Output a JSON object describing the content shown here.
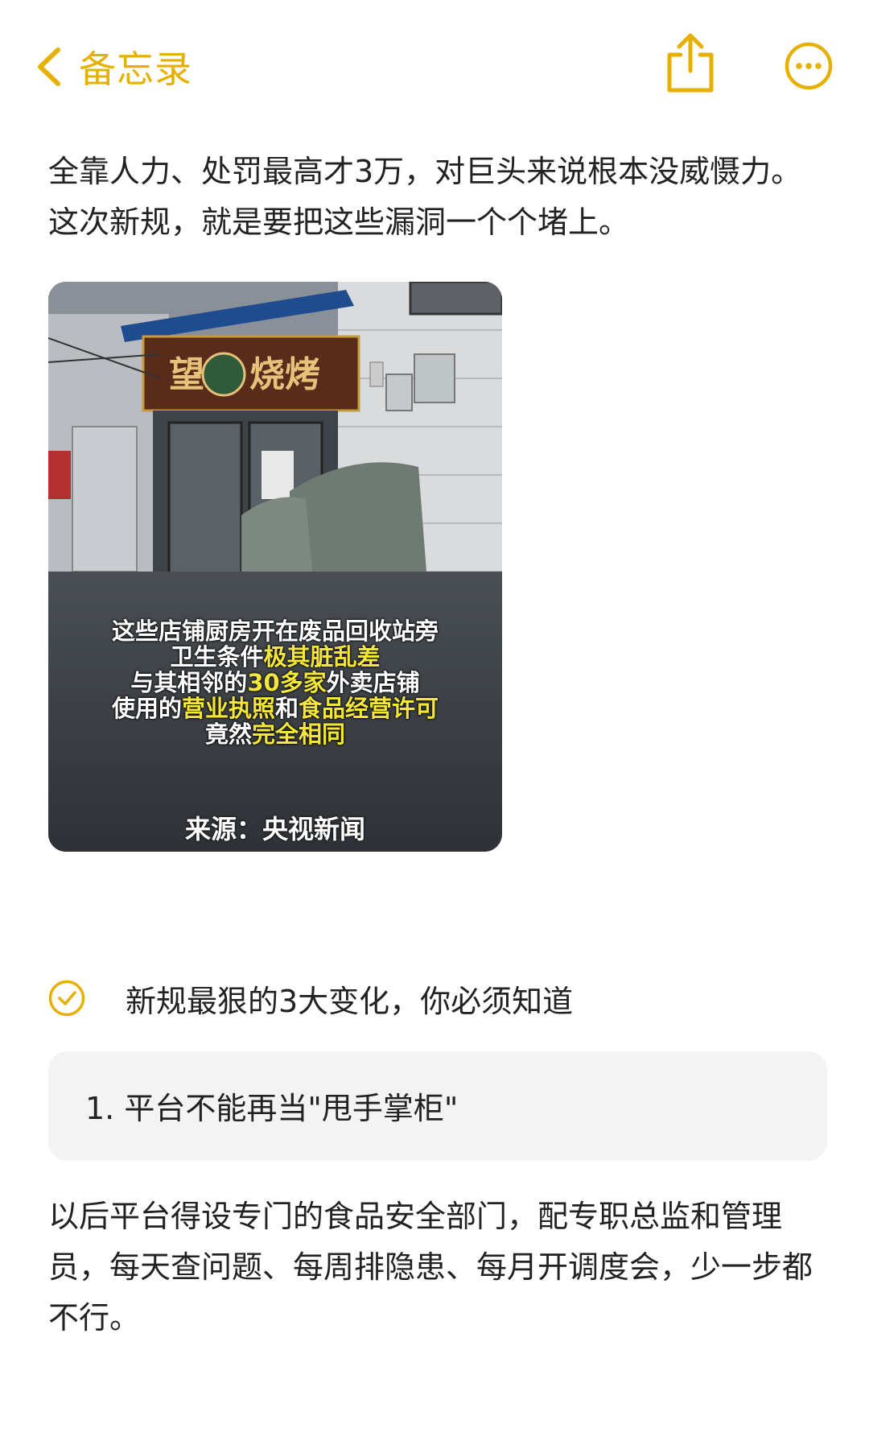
{
  "nav": {
    "back_label": "备忘录",
    "accent_color": "#e6b000",
    "icons": [
      "chevron-left-icon",
      "share-icon",
      "more-icon"
    ]
  },
  "note": {
    "paragraph1": "全靠人力、处罚最高才3万，对巨头来说根本没威慑力。这次新规，就是要把这些漏洞一个个堵上。",
    "image": {
      "sign_text": "望京 烧烤",
      "caption_lines": [
        [
          {
            "t": "这些店铺厨房开在废品回收站旁",
            "h": false
          }
        ],
        [
          {
            "t": "卫生条件",
            "h": false
          },
          {
            "t": "极其脏乱差",
            "h": true
          }
        ],
        [
          {
            "t": "与其相邻的",
            "h": false
          },
          {
            "t": "30多家",
            "h": true
          },
          {
            "t": "外卖店铺",
            "h": false
          }
        ],
        [
          {
            "t": "使用的",
            "h": false
          },
          {
            "t": "营业执照",
            "h": true
          },
          {
            "t": "和",
            "h": false
          },
          {
            "t": "食品经营许可",
            "h": true
          }
        ],
        [
          {
            "t": "竟然",
            "h": false
          },
          {
            "t": "完全相同",
            "h": true
          }
        ]
      ],
      "source": "来源：央视新闻"
    },
    "checklist_item": "新规最狠的3大变化，你必须知道",
    "checklist_checked": true,
    "card_text": "1. 平台不能再当\"甩手掌柜\"",
    "paragraph2": "以后平台得设专门的食品安全部门，配专职总监和管理员，每天查问题、每周排隐患、每月开调度会，少一步都不行。"
  }
}
